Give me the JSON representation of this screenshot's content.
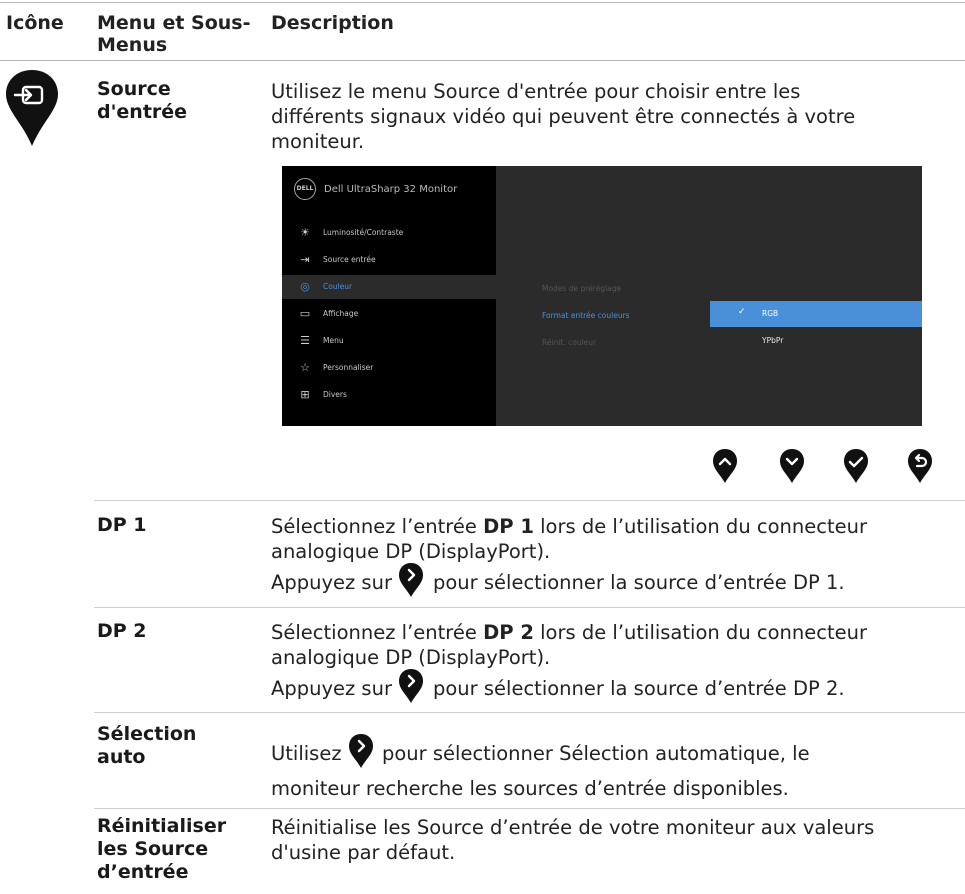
{
  "header": {
    "col1": "Icône",
    "col2_line1": "Menu et Sous-",
    "col2_line2": "Menus",
    "col3": "Description"
  },
  "main_item": {
    "label_line1": "Source",
    "label_line2": "d'entrée",
    "icon": "input-source-icon",
    "desc_line1": "Utilisez le menu Source d'entrée pour choisir entre les",
    "desc_line2": "différents signaux vidéo qui peuvent être connectés à votre",
    "desc_line3": "moniteur."
  },
  "osd": {
    "brand": "DELL",
    "title": "Dell UltraSharp 32 Monitor",
    "menu": [
      {
        "label": "Luminosité/Contraste",
        "icon": "brightness-icon"
      },
      {
        "label": "Source entrée",
        "icon": "input-source-icon"
      },
      {
        "label": "Couleur",
        "icon": "color-palette-icon"
      },
      {
        "label": "Affichage",
        "icon": "display-icon"
      },
      {
        "label": "Menu",
        "icon": "menu-icon"
      },
      {
        "label": "Personnaliser",
        "icon": "star-icon"
      },
      {
        "label": "Divers",
        "icon": "misc-icon"
      }
    ],
    "submenu": [
      "Modes de préréglage",
      "Format entrée couleurs",
      "Réinit. couleur"
    ],
    "options": [
      "RGB",
      "YPbPr"
    ],
    "selected_option": "RGB"
  },
  "buttons": [
    "up-icon",
    "down-icon",
    "check-icon",
    "back-icon"
  ],
  "rows": [
    {
      "name": "DP 1",
      "d1_pre": "Sélectionnez l’entrée ",
      "d1_bold": "DP 1",
      "d1_post": " lors de l’utilisation du connecteur",
      "d2": "analogique DP (DisplayPort).",
      "d3_pre": "Appuyez sur",
      "d3_post": "pour sélectionner la source d’entrée DP 1."
    },
    {
      "name": "DP 2",
      "d1_pre": "Sélectionnez l’entrée ",
      "d1_bold": "DP 2",
      "d1_post": " lors de l’utilisation du connecteur",
      "d2": "analogique DP (DisplayPort).",
      "d3_pre": "Appuyez sur",
      "d3_post": "pour sélectionner la source d’entrée DP 2."
    }
  ],
  "auto_row": {
    "name_line1": "Sélection",
    "name_line2": "auto",
    "d1_pre": "Utilisez",
    "d1_post": "pour sélectionner Sélection automatique, le",
    "d2": "moniteur recherche les sources d’entrée disponibles."
  },
  "reset_row": {
    "name_line1": "Réinitialiser",
    "name_line2": "les Source",
    "name_line3": "d’entrée",
    "d1": "Réinitialise les Source d’entrée de votre moniteur aux valeurs",
    "d2": "d'usine par défaut."
  },
  "colors": {
    "accent": "#4a90d9",
    "osd_bg": "#2b2b2b",
    "osd_menu_bg": "#000000"
  }
}
